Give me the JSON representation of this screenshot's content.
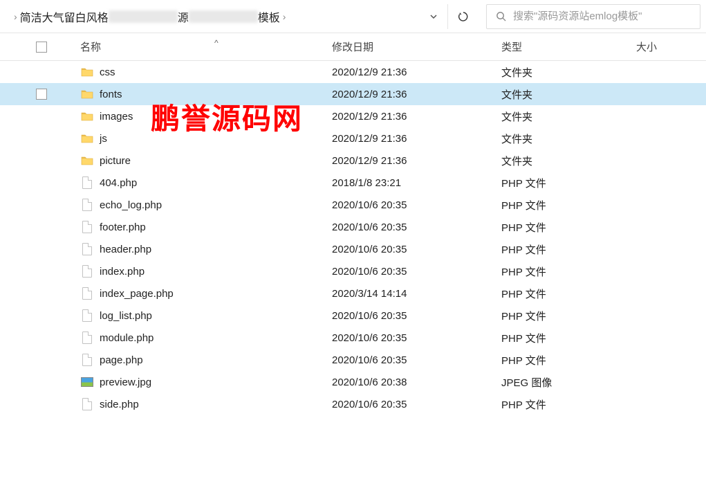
{
  "breadcrumb": {
    "part1": "简洁大气留白风格",
    "part2": "源",
    "part3": "模板"
  },
  "search": {
    "placeholder": "搜索\"源码资源站emlog模板\""
  },
  "columns": {
    "name": "名称",
    "date": "修改日期",
    "type": "类型",
    "size": "大小"
  },
  "sort_caret": "^",
  "watermark": "鹏誉源码网",
  "files": [
    {
      "name": "css",
      "date": "2020/12/9 21:36",
      "type": "文件夹",
      "icon": "folder",
      "selected": false
    },
    {
      "name": "fonts",
      "date": "2020/12/9 21:36",
      "type": "文件夹",
      "icon": "folder",
      "selected": true
    },
    {
      "name": "images",
      "date": "2020/12/9 21:36",
      "type": "文件夹",
      "icon": "folder",
      "selected": false
    },
    {
      "name": "js",
      "date": "2020/12/9 21:36",
      "type": "文件夹",
      "icon": "folder",
      "selected": false
    },
    {
      "name": "picture",
      "date": "2020/12/9 21:36",
      "type": "文件夹",
      "icon": "folder",
      "selected": false
    },
    {
      "name": "404.php",
      "date": "2018/1/8 23:21",
      "type": "PHP 文件",
      "icon": "file",
      "selected": false
    },
    {
      "name": "echo_log.php",
      "date": "2020/10/6 20:35",
      "type": "PHP 文件",
      "icon": "file",
      "selected": false
    },
    {
      "name": "footer.php",
      "date": "2020/10/6 20:35",
      "type": "PHP 文件",
      "icon": "file",
      "selected": false
    },
    {
      "name": "header.php",
      "date": "2020/10/6 20:35",
      "type": "PHP 文件",
      "icon": "file",
      "selected": false
    },
    {
      "name": "index.php",
      "date": "2020/10/6 20:35",
      "type": "PHP 文件",
      "icon": "file",
      "selected": false
    },
    {
      "name": "index_page.php",
      "date": "2020/3/14 14:14",
      "type": "PHP 文件",
      "icon": "file",
      "selected": false
    },
    {
      "name": "log_list.php",
      "date": "2020/10/6 20:35",
      "type": "PHP 文件",
      "icon": "file",
      "selected": false
    },
    {
      "name": "module.php",
      "date": "2020/10/6 20:35",
      "type": "PHP 文件",
      "icon": "file",
      "selected": false
    },
    {
      "name": "page.php",
      "date": "2020/10/6 20:35",
      "type": "PHP 文件",
      "icon": "file",
      "selected": false
    },
    {
      "name": "preview.jpg",
      "date": "2020/10/6 20:38",
      "type": "JPEG 图像",
      "icon": "jpg",
      "selected": false
    },
    {
      "name": "side.php",
      "date": "2020/10/6 20:35",
      "type": "PHP 文件",
      "icon": "file",
      "selected": false
    }
  ]
}
